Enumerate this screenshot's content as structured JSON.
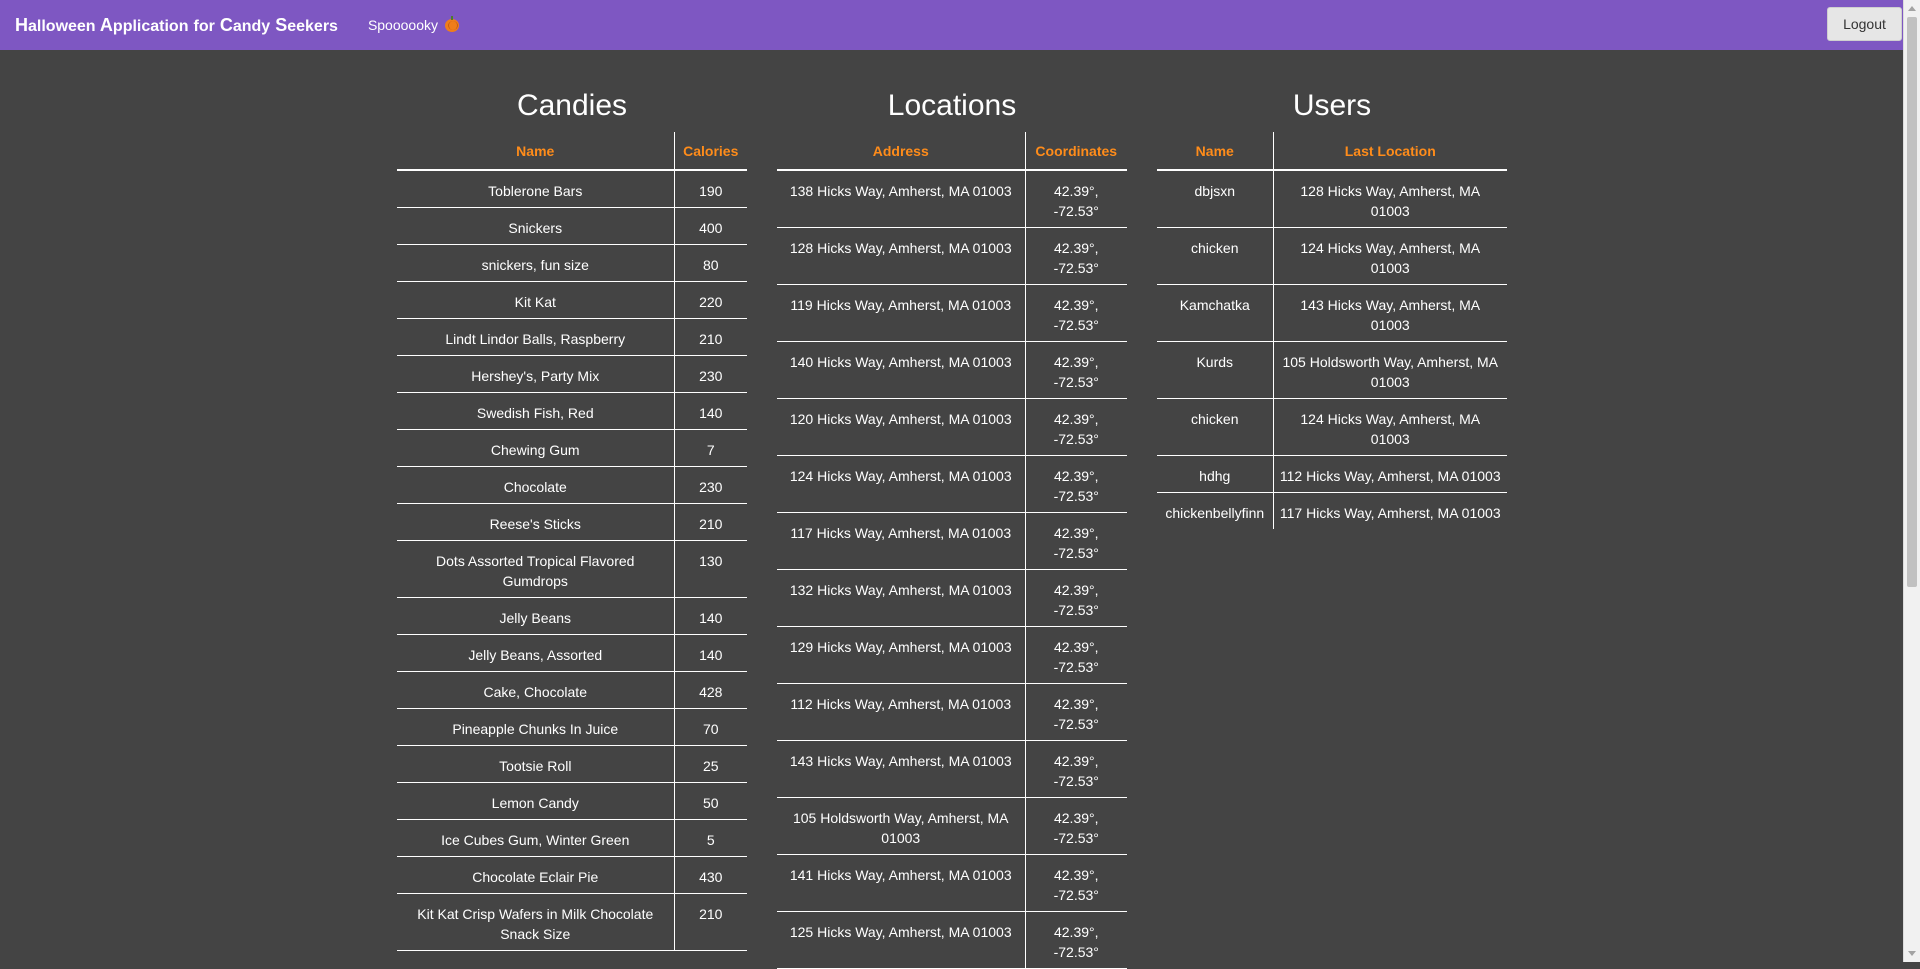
{
  "navbar": {
    "brand_words": [
      {
        "cap": "H",
        "rest": "alloween"
      },
      {
        "cap": "A",
        "rest": "pplication"
      },
      {
        "cap": "",
        "rest": "for"
      },
      {
        "cap": "C",
        "rest": "andy"
      },
      {
        "cap": "S",
        "rest": "eekers"
      }
    ],
    "subtitle": "Spoooooky",
    "logout_label": "Logout"
  },
  "candies": {
    "title": "Candies",
    "headers": [
      "Name",
      "Calories"
    ],
    "rows": [
      [
        "Toblerone Bars",
        "190"
      ],
      [
        "Snickers",
        "400"
      ],
      [
        "snickers, fun size",
        "80"
      ],
      [
        "Kit Kat",
        "220"
      ],
      [
        "Lindt Lindor Balls, Raspberry",
        "210"
      ],
      [
        "Hershey's, Party Mix",
        "230"
      ],
      [
        "Swedish Fish, Red",
        "140"
      ],
      [
        "Chewing Gum",
        "7"
      ],
      [
        "Chocolate",
        "230"
      ],
      [
        "Reese's Sticks",
        "210"
      ],
      [
        "Dots Assorted Tropical Flavored Gumdrops",
        "130"
      ],
      [
        "Jelly Beans",
        "140"
      ],
      [
        "Jelly Beans, Assorted",
        "140"
      ],
      [
        "Cake, Chocolate",
        "428"
      ],
      [
        "Pineapple Chunks In Juice",
        "70"
      ],
      [
        "Tootsie Roll",
        "25"
      ],
      [
        "Lemon Candy",
        "50"
      ],
      [
        "Ice Cubes Gum, Winter Green",
        "5"
      ],
      [
        "Chocolate Eclair Pie",
        "430"
      ],
      [
        "Kit Kat Crisp Wafers in Milk Chocolate Snack Size",
        "210"
      ]
    ]
  },
  "locations": {
    "title": "Locations",
    "headers": [
      "Address",
      "Coordinates"
    ],
    "rows": [
      [
        "138 Hicks Way, Amherst, MA 01003",
        "42.39°, -72.53°"
      ],
      [
        "128 Hicks Way, Amherst, MA 01003",
        "42.39°, -72.53°"
      ],
      [
        "119 Hicks Way, Amherst, MA 01003",
        "42.39°, -72.53°"
      ],
      [
        "140 Hicks Way, Amherst, MA 01003",
        "42.39°, -72.53°"
      ],
      [
        "120 Hicks Way, Amherst, MA 01003",
        "42.39°, -72.53°"
      ],
      [
        "124 Hicks Way, Amherst, MA 01003",
        "42.39°, -72.53°"
      ],
      [
        "117 Hicks Way, Amherst, MA 01003",
        "42.39°, -72.53°"
      ],
      [
        "132 Hicks Way, Amherst, MA 01003",
        "42.39°, -72.53°"
      ],
      [
        "129 Hicks Way, Amherst, MA 01003",
        "42.39°, -72.53°"
      ],
      [
        "112 Hicks Way, Amherst, MA 01003",
        "42.39°, -72.53°"
      ],
      [
        "143 Hicks Way, Amherst, MA 01003",
        "42.39°, -72.53°"
      ],
      [
        "105 Holdsworth Way, Amherst, MA 01003",
        "42.39°, -72.53°"
      ],
      [
        "141 Hicks Way, Amherst, MA 01003",
        "42.39°, -72.53°"
      ],
      [
        "125 Hicks Way, Amherst, MA 01003",
        "42.39°, -72.53°"
      ]
    ]
  },
  "users": {
    "title": "Users",
    "headers": [
      "Name",
      "Last Location"
    ],
    "rows": [
      [
        "dbjsxn",
        "128 Hicks Way, Amherst, MA 01003"
      ],
      [
        "chicken",
        "124 Hicks Way, Amherst, MA 01003"
      ],
      [
        "Kamchatka",
        "143 Hicks Way, Amherst, MA 01003"
      ],
      [
        "Kurds",
        "105 Holdsworth Way, Amherst, MA 01003"
      ],
      [
        "chicken",
        "124 Hicks Way, Amherst, MA 01003"
      ],
      [
        "hdhg",
        "112 Hicks Way, Amherst, MA 01003"
      ],
      [
        "chickenbellyfinn",
        "117 Hicks Way, Amherst, MA 01003"
      ]
    ]
  }
}
